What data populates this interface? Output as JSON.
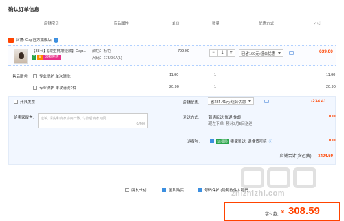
{
  "page_title": "确认订单信息",
  "columns": [
    "店铺宝贝",
    "商品属性",
    "单价",
    "数量",
    "优惠方式",
    "小计"
  ],
  "store": {
    "name": "店铺: Gap官方旗舰店"
  },
  "item": {
    "name": "【38节】【款型挑眼短款】Gap...",
    "badges": [
      "7",
      "⊕",
      "38抢先购"
    ],
    "attr_color": "颜色：棕色",
    "attr_size": "尺码：175/96A(L)",
    "price": "799.00",
    "qty": "1",
    "qty_minus": "−",
    "qty_plus": "+",
    "discount": "已省160元:组合优惠",
    "subtotal": "639.00"
  },
  "service": {
    "label": "售后服务",
    "rows": [
      {
        "name": "专业洗护 单次清洗",
        "price": "11.90",
        "qty": "1",
        "sub": "11.90"
      },
      {
        "name": "专业洗护 单次清洗2件",
        "price": "20.90",
        "qty": "1",
        "sub": "20.90"
      }
    ]
  },
  "invoice": {
    "label": "开具发票"
  },
  "store_discount": {
    "label": "店铺优惠:",
    "value": "省234.41元:组合优惠",
    "amount": "-234.41"
  },
  "message": {
    "label": "给卖家留言:",
    "placeholder": "选填, 请先和商家协商一致, 付款后商家可见",
    "count": "0/200"
  },
  "shipping": {
    "label": "运送方式:",
    "method": "普通配送 快递 免邮",
    "eta": "现在下单, 预计3月5日送达",
    "fee": "0.00"
  },
  "insurance": {
    "label": "运费险:",
    "tag": "运费险",
    "desc": "卖家赠送, 退换货可赔",
    "fee": "0.00"
  },
  "store_total": {
    "label": "店铺合计(含运费)",
    "value": "¥404.59"
  },
  "options": {
    "anon": "朋友代付",
    "anonymous_buy": "匿名购买",
    "privacy": "号码保护 (隐藏收件人号码...)"
  },
  "pay": {
    "label": "实付款:",
    "symbol": "¥",
    "amount": "308.59"
  },
  "watermark": "zhizhizhi.com"
}
